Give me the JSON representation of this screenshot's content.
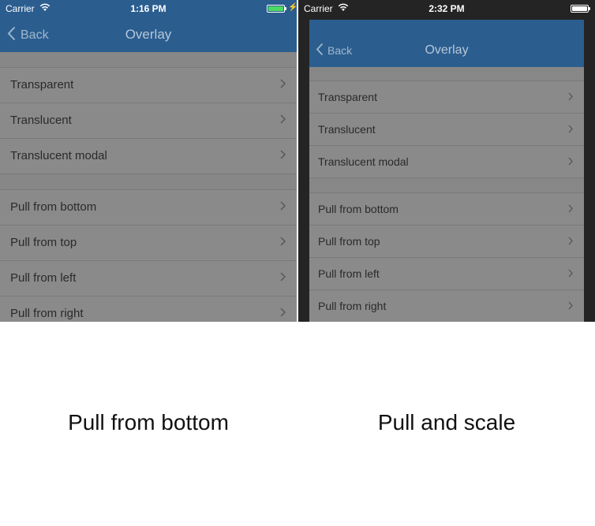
{
  "left": {
    "status": {
      "carrier": "Carrier",
      "time": "1:16 PM"
    },
    "nav": {
      "back_label": "Back",
      "title": "Overlay"
    },
    "section1": [
      "Transparent",
      "Translucent",
      "Translucent modal"
    ],
    "section2": [
      "Pull from bottom",
      "Pull from top",
      "Pull from left",
      "Pull from right"
    ],
    "caption": "Pull from bottom"
  },
  "right": {
    "status": {
      "carrier": "Carrier",
      "time": "2:32 PM"
    },
    "nav": {
      "back_label": "Back",
      "title": "Overlay"
    },
    "section1": [
      "Transparent",
      "Translucent",
      "Translucent modal"
    ],
    "section2": [
      "Pull from bottom",
      "Pull from top",
      "Pull from left",
      "Pull from right"
    ],
    "caption": "Pull and scale"
  },
  "colors": {
    "navbar": "#2b5d8f",
    "battery_charging": "#4cd964",
    "dimmed_list": "#8a8a8a",
    "scaled_backdrop": "#242424"
  },
  "icons": {
    "back": "chevron-left-icon",
    "row": "chevron-right-icon",
    "wifi": "wifi-icon",
    "battery": "battery-icon",
    "charging": "bolt-icon"
  }
}
